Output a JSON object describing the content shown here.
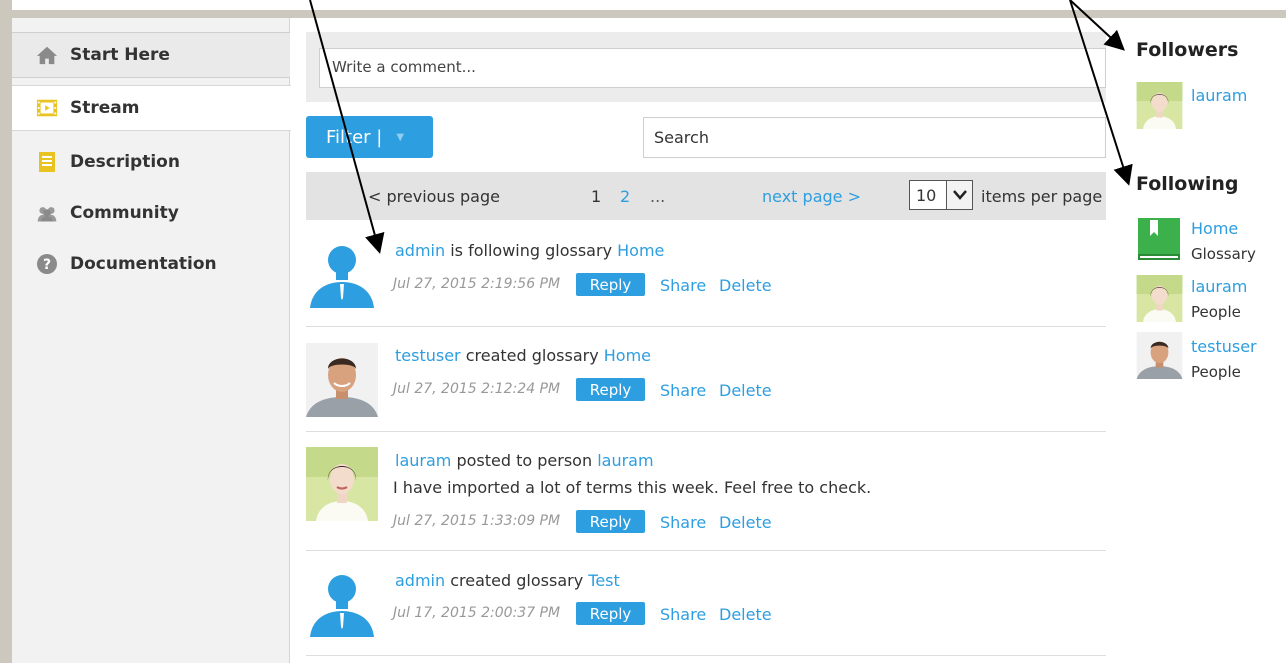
{
  "sidebar": {
    "items": [
      {
        "label": "Start Here",
        "icon": "home-icon"
      },
      {
        "label": "Stream",
        "icon": "film-icon"
      },
      {
        "label": "Description",
        "icon": "document-icon"
      },
      {
        "label": "Community",
        "icon": "people-icon"
      },
      {
        "label": "Documentation",
        "icon": "help-icon"
      }
    ]
  },
  "comment": {
    "placeholder": "Write a comment..."
  },
  "filter": {
    "label": "Filter |",
    "caret": "▼"
  },
  "search": {
    "placeholder": "Search"
  },
  "pager": {
    "prev": "< previous page",
    "pages": [
      "1",
      "2"
    ],
    "ellipsis": "...",
    "next": "next page >",
    "items_per_page_value": "10",
    "items_per_page_label": "items per page"
  },
  "stream": [
    {
      "user": "admin",
      "action": "is following glossary",
      "target": "Home",
      "text": "",
      "time": "Jul 27, 2015 2:19:56 PM",
      "avatar": "silhouette"
    },
    {
      "user": "testuser",
      "action": "created glossary",
      "target": "Home",
      "text": "",
      "time": "Jul 27, 2015 2:12:24 PM",
      "avatar": "man"
    },
    {
      "user": "lauram",
      "action": "posted to person",
      "target": "lauram",
      "text": "I have imported a lot of terms this week. Feel free to check.",
      "time": "Jul 27, 2015 1:33:09 PM",
      "avatar": "woman"
    },
    {
      "user": "admin",
      "action": "created glossary",
      "target": "Test",
      "text": "",
      "time": "Jul 17, 2015 2:00:37 PM",
      "avatar": "silhouette"
    }
  ],
  "actions": {
    "reply": "Reply",
    "share": "Share",
    "delete": "Delete"
  },
  "followers": {
    "title": "Followers",
    "items": [
      {
        "name": "lauram"
      }
    ]
  },
  "following": {
    "title": "Following",
    "items": [
      {
        "name": "Home",
        "type": "Glossary"
      },
      {
        "name": "lauram",
        "type": "People"
      },
      {
        "name": "testuser",
        "type": "People"
      }
    ]
  },
  "colors": {
    "accent": "#2d9ee0",
    "sidebar_bg": "#f2f2f2",
    "pager_bg": "#e3e3e3"
  }
}
